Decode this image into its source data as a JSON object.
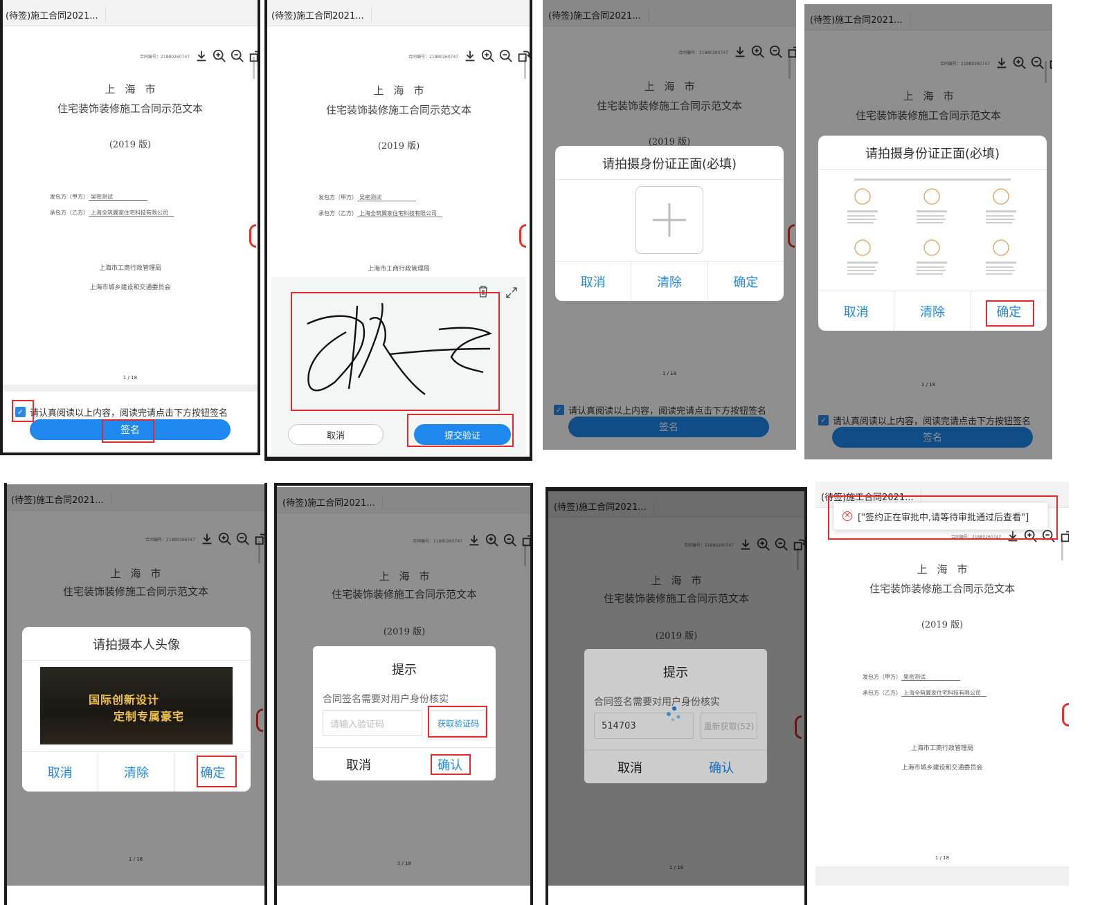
{
  "tab_title": "(待签)施工合同2021...",
  "document": {
    "contract_no_label": "合同编号：",
    "contract_no_value": "21880260747",
    "city": "上海市",
    "title": "住宅装饰装修施工合同示范文本",
    "version": "(2019 版)",
    "party_a_label": "发包方（甲方）",
    "party_a_value": "吴密测试",
    "party_b_label": "承包方（乙方）",
    "party_b_value": "上海全筑翼家住宅科技有限公司",
    "issuer_1": "上海市工商行政管理局",
    "issuer_2": "上海市城乡建设和交通委员会",
    "page_indicator": "1 / 18"
  },
  "toolbar_icons": [
    "download-icon",
    "zoom-in-icon",
    "zoom-out-icon",
    "rotate-icon",
    "refresh-icon"
  ],
  "consent": {
    "checkbox_checked": true,
    "text": "请认真阅读以上内容，阅读完请点击下方按钮签名"
  },
  "sign_button": "签名",
  "signature_pad": {
    "cancel": "取消",
    "submit": "提交验证"
  },
  "id_photo_modal": {
    "title": "请拍摄身份证正面(必填)",
    "cancel": "取消",
    "clear": "清除",
    "confirm": "确定"
  },
  "portrait_modal": {
    "title": "请拍摄本人头像",
    "photo_text_1": "国际创新设计",
    "photo_text_2": "定制专属豪宅",
    "cancel": "取消",
    "clear": "清除",
    "confirm": "确定"
  },
  "verify_modal": {
    "title": "提示",
    "message": "合同签名需要对用户身份核实",
    "code_placeholder": "请输入验证码",
    "get_code": "获取验证码",
    "code_value": "514703",
    "resend": "重新获取(52)",
    "cancel": "取消",
    "confirm": "确认"
  },
  "error_toast": {
    "message": "[\"签约正在审批中,请等待审批通过后查看\"]"
  },
  "colors": {
    "accent": "#1e88ef",
    "highlight": "#e32b2b",
    "overlay": "rgba(0,0,0,0.44)"
  }
}
